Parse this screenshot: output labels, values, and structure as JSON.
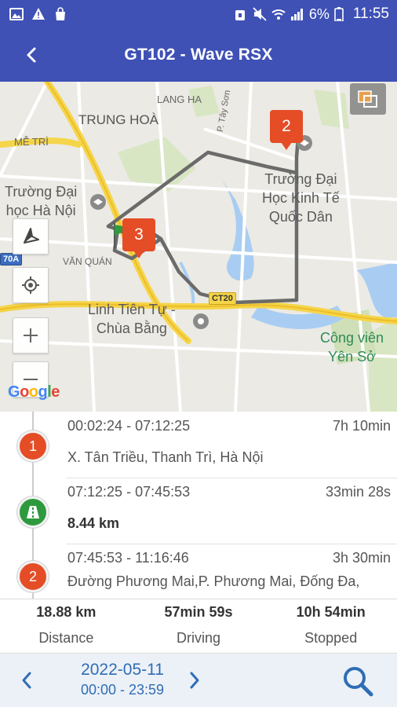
{
  "status_bar": {
    "battery": "6%",
    "time": "11:55"
  },
  "header": {
    "title": "GT102 - Wave RSX"
  },
  "map": {
    "labels": {
      "lang_ha": "LANG HA",
      "trung_hoa": "TRUNG HOÀ",
      "me_tri": "MỄ TRÌ",
      "p_tay_son": "P. Tây Sơn",
      "van_quan": "VĂN QUÁN",
      "dh_ha_noi_1": "Trường Đại",
      "dh_ha_noi_2": "học Hà Nội",
      "dh_ktqd_1": "Trường Đại",
      "dh_ktqd_2": "Học Kinh Tế",
      "dh_ktqd_3": "Quốc Dân",
      "linh_tien_1": "Linh Tiên Tự -",
      "linh_tien_2": "Chùa Bằng",
      "cong_vien_1": "Công viên",
      "cong_vien_2": "Yên Sở",
      "road_ct20": "CT20",
      "road_70a": "70A"
    },
    "markers": [
      "2",
      "3"
    ],
    "google_logo": "Google",
    "colors": {
      "route": "#6b6b6b",
      "marker": "#e44d26",
      "highway": "#f5d54a"
    }
  },
  "timeline": [
    {
      "type": "stop",
      "index": "1",
      "time_range": "00:02:24 - 07:12:25",
      "duration": "7h 10min",
      "detail": "X. Tân Triều, Thanh Trì, Hà Nội"
    },
    {
      "type": "drive",
      "time_range": "07:12:25 - 07:45:53",
      "duration": "33min 28s",
      "detail": "8.44 km"
    },
    {
      "type": "stop",
      "index": "2",
      "time_range": "07:45:53 - 11:16:46",
      "duration": "3h 30min",
      "detail": "Đường Phương Mai,P. Phương Mai, Đống Đa,"
    }
  ],
  "summary": [
    {
      "value": "18.88 km",
      "label": "Distance"
    },
    {
      "value": "57min 59s",
      "label": "Driving"
    },
    {
      "value": "10h 54min",
      "label": "Stopped"
    }
  ],
  "date_bar": {
    "date": "2022-05-11",
    "range": "00:00 - 23:59"
  }
}
